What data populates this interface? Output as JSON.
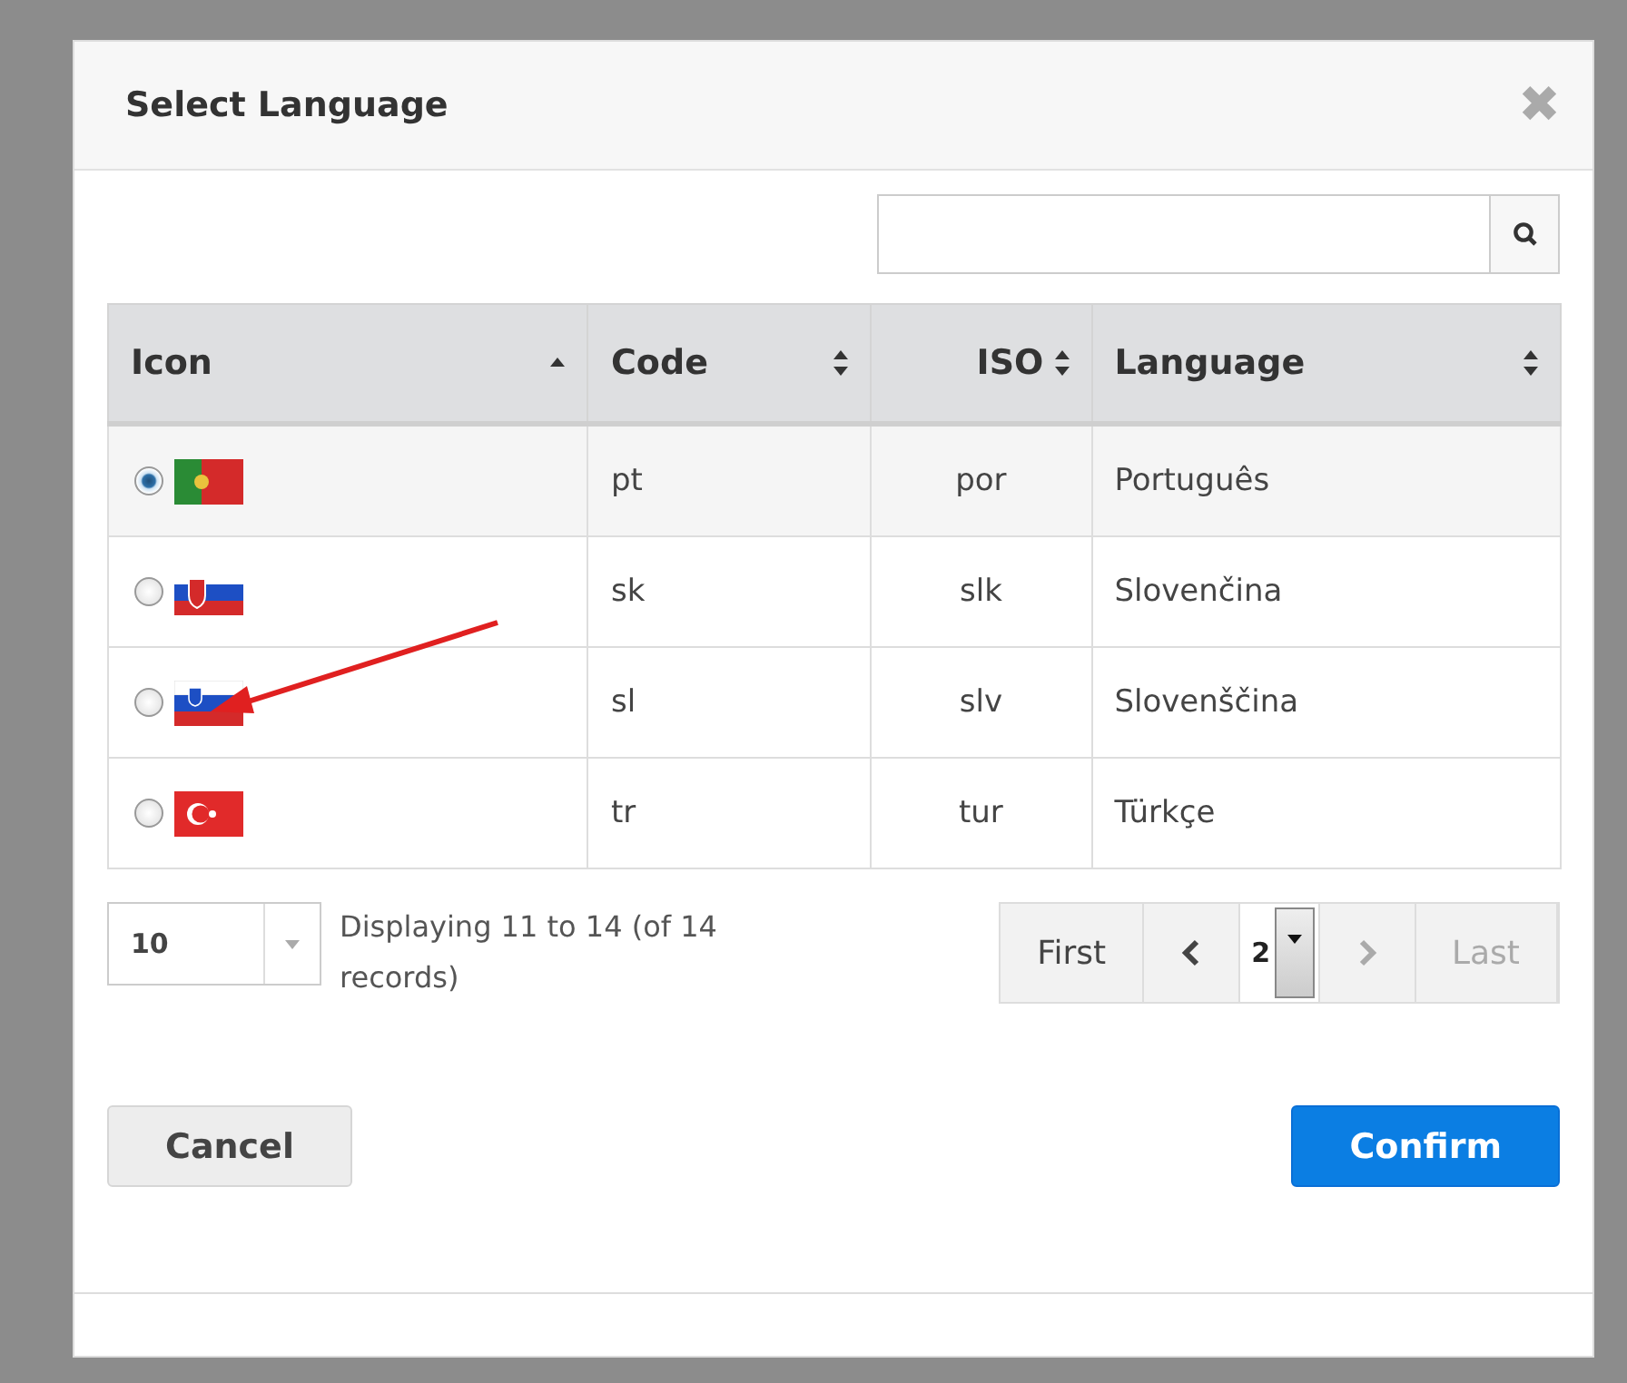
{
  "dialog": {
    "title": "Select Language",
    "close": "✖"
  },
  "table": {
    "columns": [
      {
        "label": "Icon",
        "kind": "ascending"
      },
      {
        "label": "Code",
        "kind": "sortable"
      },
      {
        "label": "ISO",
        "kind": "sortable"
      },
      {
        "label": "Language",
        "kind": "sortable"
      }
    ],
    "rows": [
      {
        "selected": true,
        "kind": "pt",
        "code": "pt",
        "iso": "por",
        "language": "Português"
      },
      {
        "selected": false,
        "kind": "sk",
        "code": "sk",
        "iso": "slk",
        "language": "Slovenčina"
      },
      {
        "selected": false,
        "kind": "si",
        "code": "sl",
        "iso": "slv",
        "language": "Slovenščina"
      },
      {
        "selected": false,
        "kind": "tr",
        "code": "tr",
        "iso": "tur",
        "language": "Türkçe"
      }
    ]
  },
  "page_size": "10",
  "summary": "Displaying 11 to 14 (of 14 records)",
  "pagination": [
    {
      "kind": "text",
      "label": "First",
      "disabled": false
    },
    {
      "kind": "prev",
      "disabled": false
    },
    {
      "kind": "page",
      "label": "2"
    },
    {
      "kind": "next",
      "disabled": true
    },
    {
      "kind": "text",
      "label": "Last",
      "disabled": true
    }
  ],
  "buttons": [
    {
      "label": "Cancel",
      "kind": "secondary"
    },
    {
      "label": "Confirm",
      "kind": "primary"
    }
  ]
}
